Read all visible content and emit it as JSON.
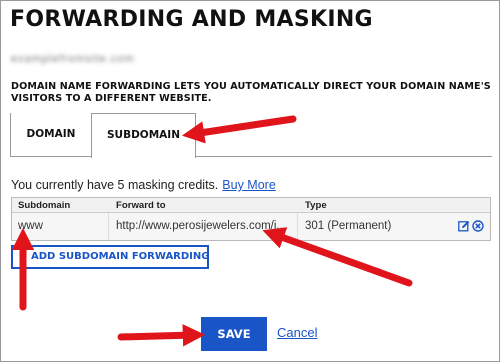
{
  "page": {
    "title": "FORWARDING AND MASKING",
    "domain_name": "examplefromsite.com",
    "description": "DOMAIN NAME FORWARDING LETS YOU AUTOMATICALLY DIRECT YOUR DOMAIN NAME'S VISITORS TO A DIFFERENT WEBSITE."
  },
  "tabs": [
    {
      "label": "DOMAIN",
      "active": false
    },
    {
      "label": "SUBDOMAIN",
      "active": true
    }
  ],
  "credits": {
    "text": "You currently have 5 masking credits.",
    "link": "Buy More"
  },
  "table": {
    "headers": [
      "Subdomain",
      "Forward to",
      "Type"
    ],
    "rows": [
      {
        "subdomain": "www",
        "forward_to": "http://www.perosijewelers.com/i...",
        "type": "301 (Permanent)"
      }
    ]
  },
  "buttons": {
    "add": "ADD SUBDOMAIN FORWARDING",
    "save": "SAVE",
    "cancel": "Cancel"
  },
  "icons": {
    "edit": "edit-icon",
    "delete": "delete-icon",
    "arrow": "red-arrow-icon"
  },
  "colors": {
    "accent": "#1a55c7",
    "annotation": "#e0141b"
  }
}
